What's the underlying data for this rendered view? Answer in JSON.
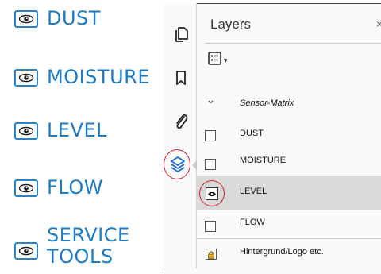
{
  "legend": {
    "items": [
      {
        "label": "DUST"
      },
      {
        "label": "MOISTURE"
      },
      {
        "label": "LEVEL"
      },
      {
        "label": "FLOW"
      },
      {
        "label_line1": "SERVICE",
        "label_line2": "TOOLS"
      }
    ]
  },
  "panel": {
    "title": "Layers",
    "close_glyph": "×",
    "options_caret": "▾",
    "group": {
      "name": "Sensor-Matrix",
      "caret": "⌄"
    },
    "layers": [
      {
        "label": "DUST",
        "visible_icon": "empty-checkbox"
      },
      {
        "label": "MOISTURE",
        "visible_icon": "empty-checkbox"
      },
      {
        "label": "LEVEL",
        "visible_icon": "eye-icon",
        "selected": true
      },
      {
        "label": "FLOW",
        "visible_icon": "empty-checkbox"
      },
      {
        "label": "Hintergrund/Logo etc.",
        "visible_icon": "lock-icon"
      }
    ]
  },
  "toolstrip": {
    "icons": [
      "pages-icon",
      "bookmark-icon",
      "attachment-icon",
      "layers-icon"
    ]
  },
  "colors": {
    "legend_blue": "#1e7bc2",
    "highlight_red": "#d0202a",
    "selected_row": "#d9d9d9",
    "lock_gold": "#e0a828"
  }
}
